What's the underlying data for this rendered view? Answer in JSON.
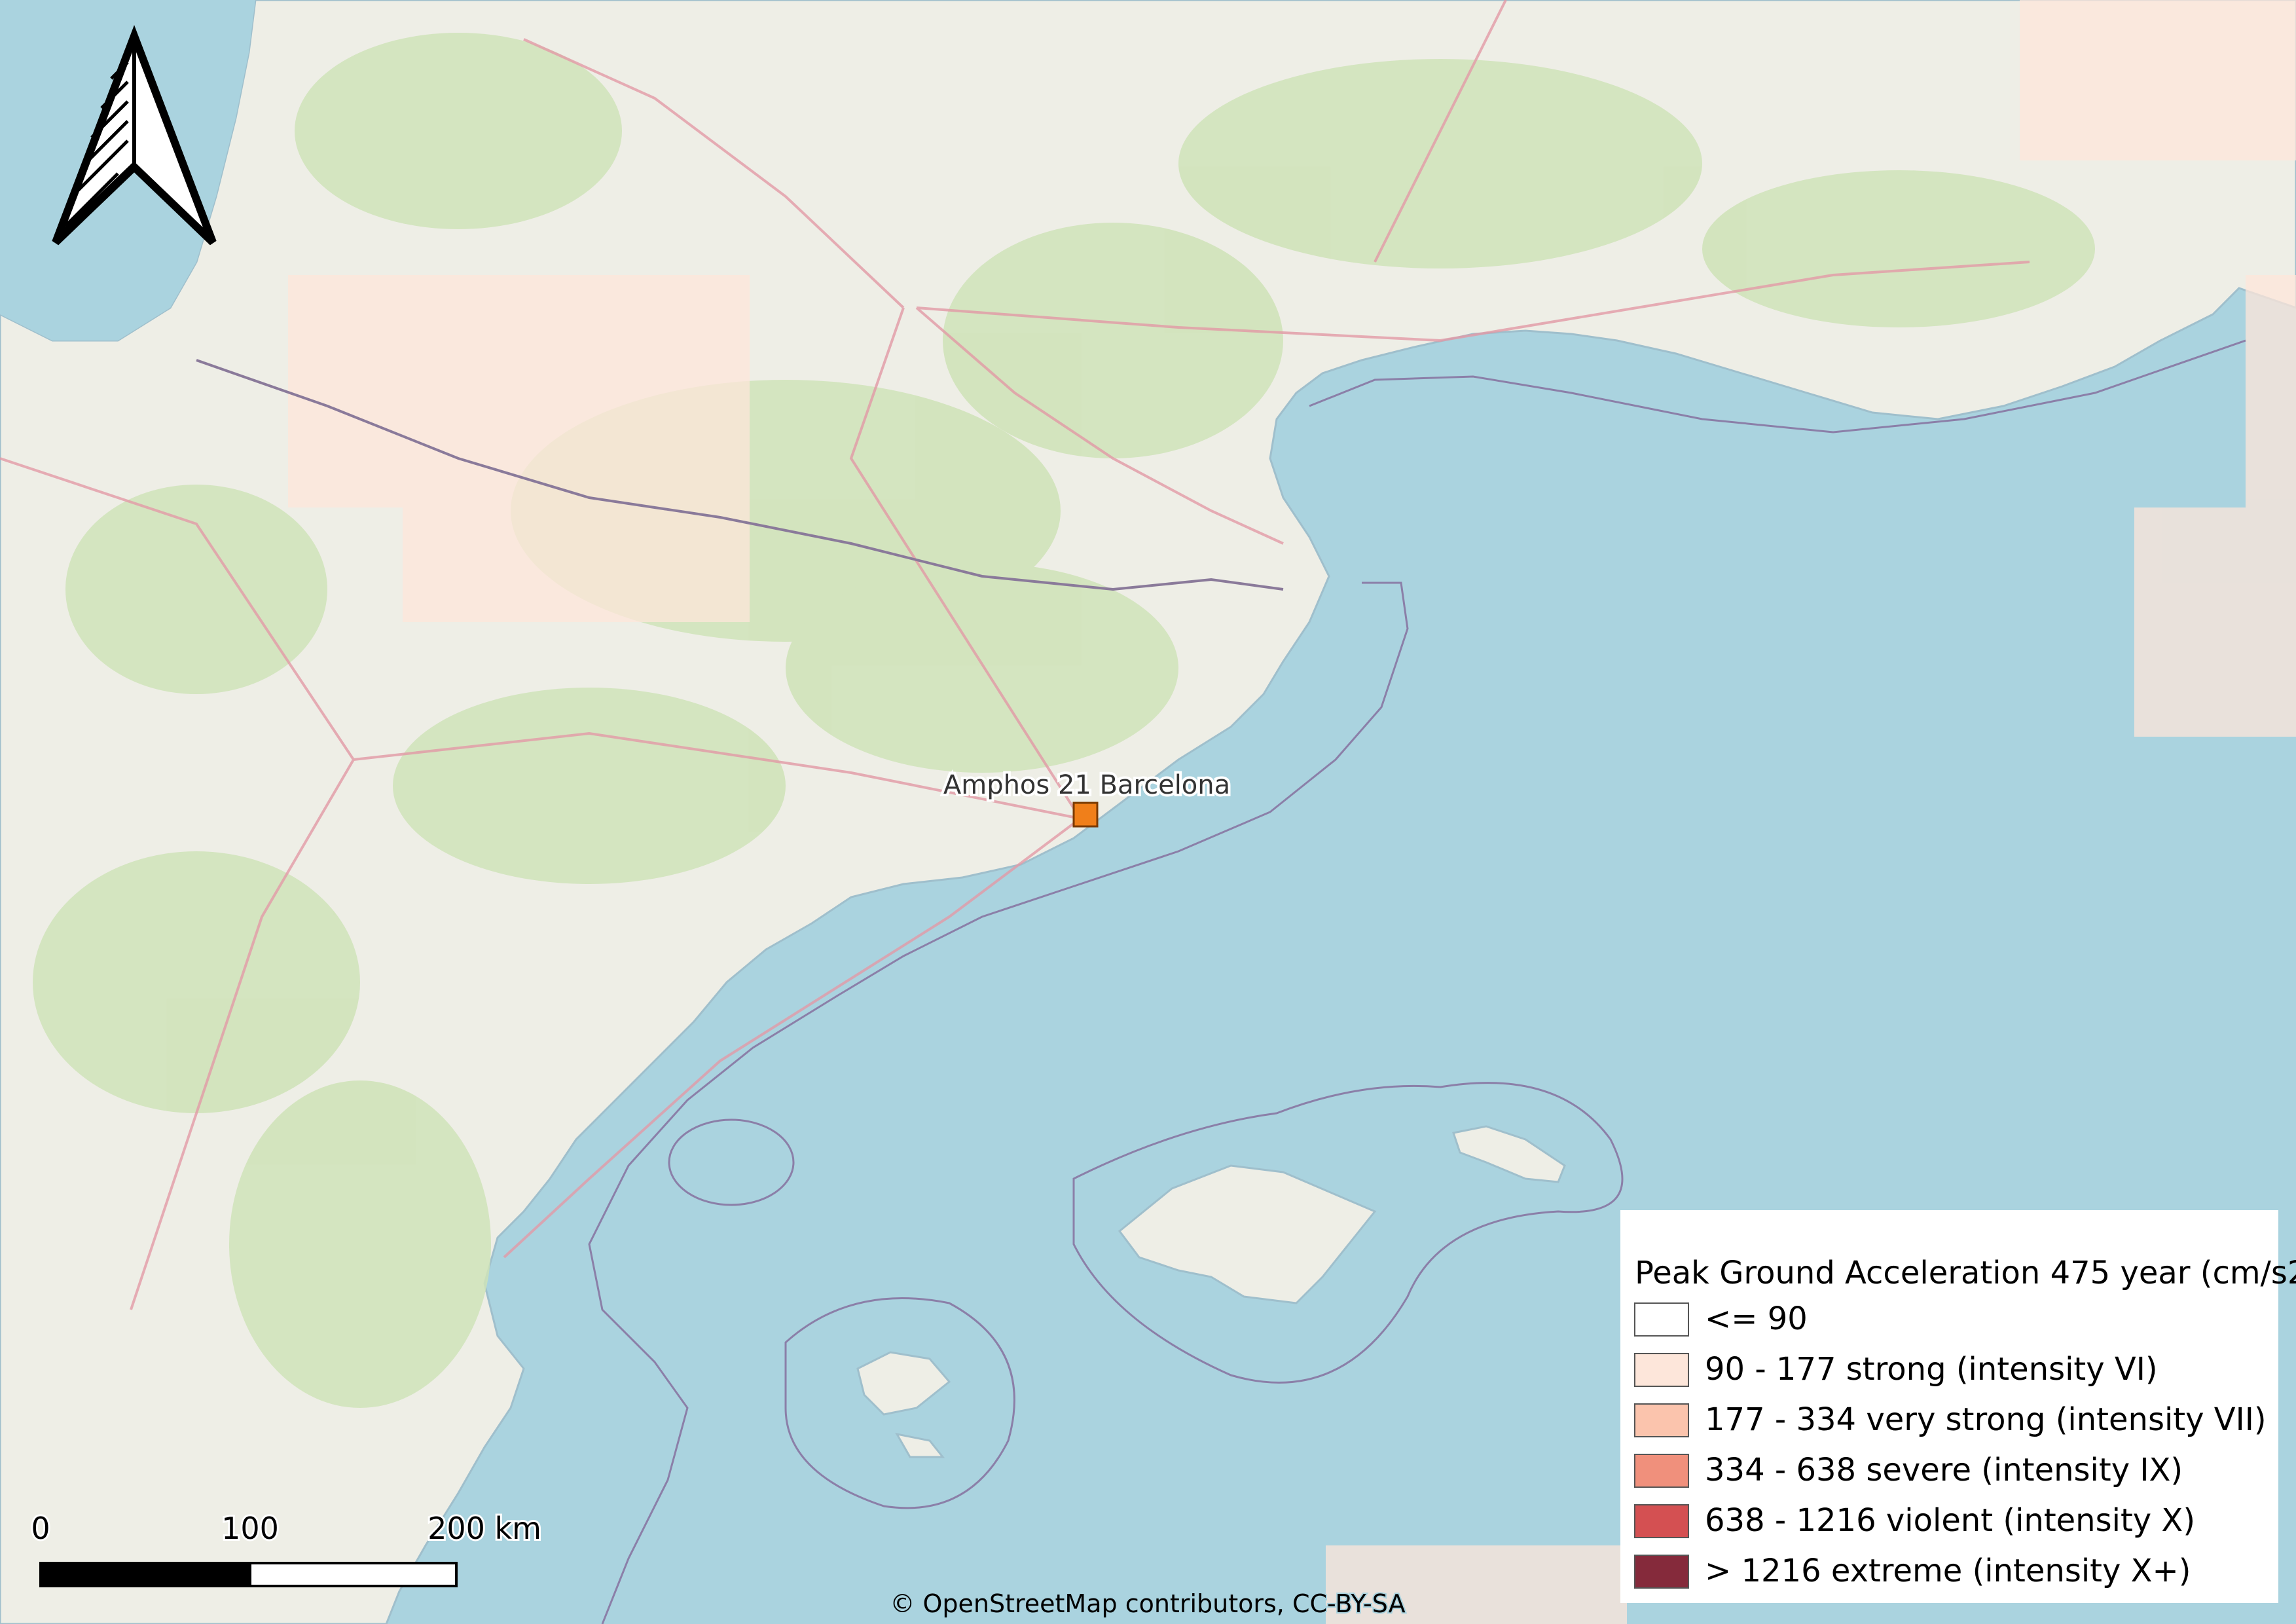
{
  "map": {
    "site_label": "Amphos 21 Barcelona",
    "site_color": "#f07f1a",
    "attribution": "© OpenStreetMap contributors, CC-BY-SA",
    "colors": {
      "sea": "#aad3df",
      "land": "#eeeee6",
      "forest": "#cfe3b8",
      "boundary": "#8a7a9a",
      "road": "#e29aa6"
    }
  },
  "legend": {
    "title": "Peak Ground Acceleration 475 year (cm/s2)",
    "items": [
      {
        "label": "<= 90",
        "color": "#ffffff"
      },
      {
        "label": "90 - 177 strong (intensity VI)",
        "color": "#fde6da"
      },
      {
        "label": "177 - 334 very strong (intensity VII)",
        "color": "#fbc4ad"
      },
      {
        "label": "334 - 638 severe (intensity IX)",
        "color": "#f0907c"
      },
      {
        "label": "638 - 1216 violent (intensity X)",
        "color": "#d45052"
      },
      {
        "label": "> 1216 extreme (intensity X+)",
        "color": "#852a3b"
      }
    ]
  },
  "scale_bar": {
    "labels": [
      "0",
      "100",
      "200 km"
    ]
  },
  "north_arrow": {
    "icon": "north-arrow-icon"
  }
}
